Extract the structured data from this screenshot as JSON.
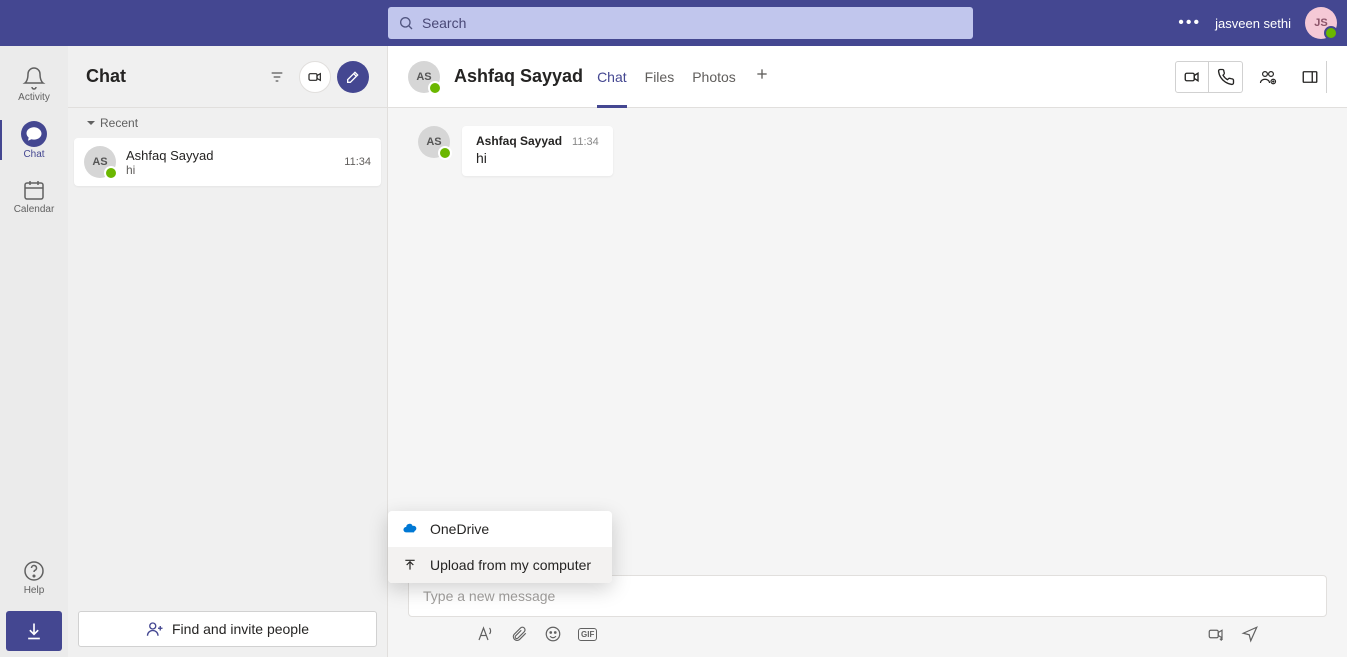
{
  "topbar": {
    "search_placeholder": "Search",
    "user_name": "jasveen sethi",
    "user_initials": "JS"
  },
  "rail": {
    "activity": "Activity",
    "chat": "Chat",
    "calendar": "Calendar",
    "help": "Help"
  },
  "listpane": {
    "title": "Chat",
    "section_recent": "Recent",
    "items": [
      {
        "initials": "AS",
        "name": "Ashfaq Sayyad",
        "preview": "hi",
        "time": "11:34"
      }
    ],
    "invite_label": "Find and invite people"
  },
  "convo": {
    "header": {
      "initials": "AS",
      "title": "Ashfaq Sayyad",
      "tabs": {
        "chat": "Chat",
        "files": "Files",
        "photos": "Photos"
      }
    },
    "messages": [
      {
        "initials": "AS",
        "from": "Ashfaq Sayyad",
        "ts": "11:34",
        "body": "hi"
      }
    ],
    "composer_placeholder": "Type a new message"
  },
  "attach_menu": {
    "onedrive": "OneDrive",
    "upload": "Upload from my computer"
  }
}
